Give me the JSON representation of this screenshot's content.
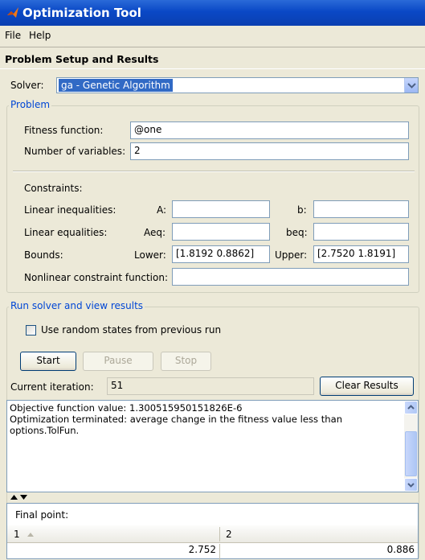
{
  "window": {
    "title": "Optimization Tool",
    "icon": "matlab-icon"
  },
  "menu": {
    "items": [
      "File",
      "Help"
    ]
  },
  "section_title": "Problem Setup and Results",
  "solver": {
    "label": "Solver:",
    "value": "ga - Genetic Algorithm"
  },
  "problem": {
    "legend": "Problem",
    "fitness_label": "Fitness function:",
    "fitness_value": "@one",
    "nvars_label": "Number of variables:",
    "nvars_value": "2"
  },
  "constraints": {
    "title": "Constraints:",
    "lin_ineq_label": "Linear inequalities:",
    "A_label": "A:",
    "b_label": "b:",
    "lin_eq_label": "Linear equalities:",
    "Aeq_label": "Aeq:",
    "beq_label": "beq:",
    "bounds_label": "Bounds:",
    "lower_label": "Lower:",
    "lower_value": "[1.8192 0.8862]",
    "upper_label": "Upper:",
    "upper_value": "[2.7520 1.8191]",
    "nonlin_label": "Nonlinear constraint function:"
  },
  "run": {
    "legend": "Run solver and view results",
    "random_states_label": "Use random states from previous run",
    "start": "Start",
    "pause": "Pause",
    "stop": "Stop",
    "iteration_label": "Current iteration:",
    "iteration_value": "51",
    "clear": "Clear Results",
    "output_line1": "Objective function value: 1.300515950151826E-6",
    "output_line2": "Optimization terminated: average change in the fitness value less than",
    "output_line3": "options.TolFun."
  },
  "final_point": {
    "title": "Final point:",
    "columns": [
      "1",
      "2"
    ],
    "values": [
      "2.752",
      "0.886"
    ]
  }
}
